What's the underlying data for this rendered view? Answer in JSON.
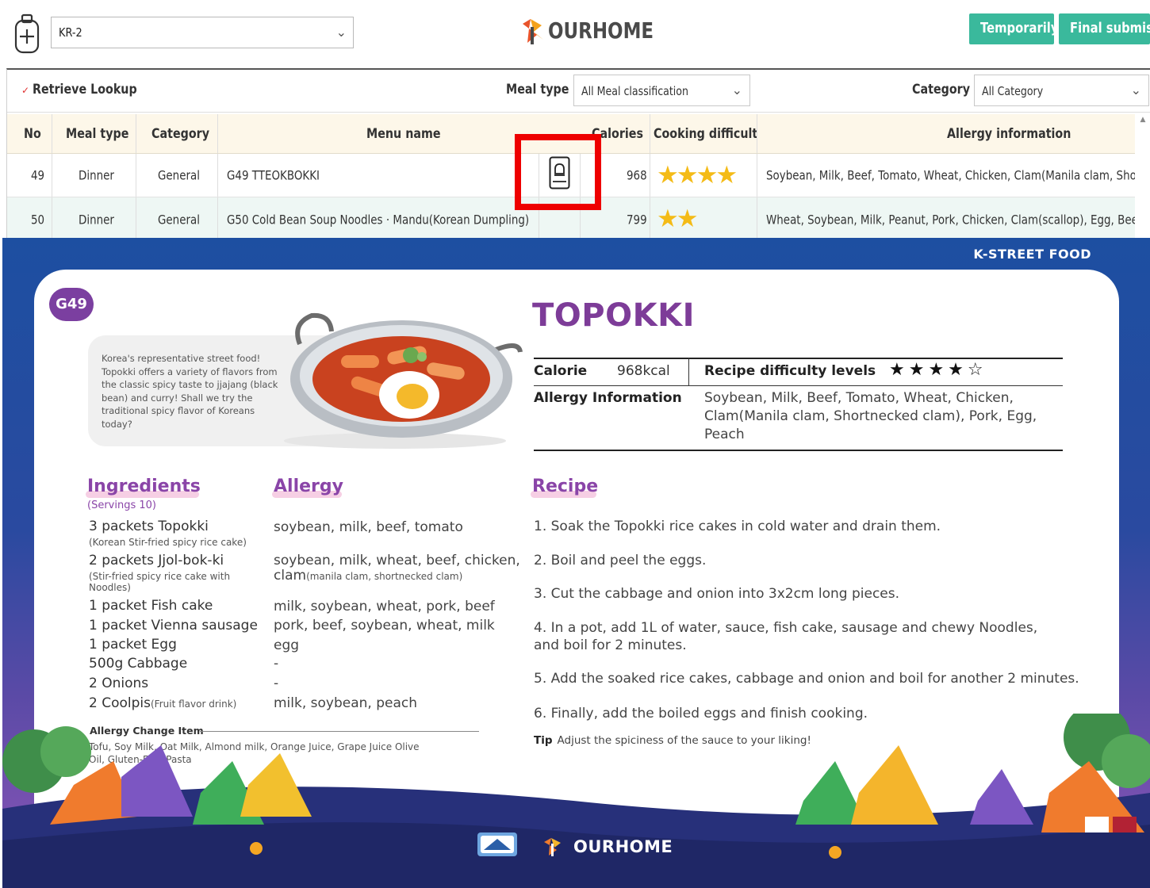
{
  "header": {
    "store_value": "KR-2",
    "brand": "OURHOME",
    "buttons": {
      "temporarily": "Temporarily sa",
      "final": "Final submis"
    }
  },
  "lookup": {
    "title": "Retrieve Lookup",
    "meal_type_label": "Meal type",
    "meal_type_value": "All Meal classification",
    "category_label": "Category",
    "category_value": "All Category",
    "columns": [
      "No",
      "Meal type",
      "Category",
      "Menu name",
      "Calories",
      "Cooking difficulty",
      "Allergy information"
    ],
    "rows": [
      {
        "no": "49",
        "meal_type": "Dinner",
        "category": "General",
        "menu_name": "G49 TTEOKBOKKI",
        "calories": "968",
        "difficulty": 4,
        "allergy": "Soybean, Milk, Beef, Tomato, Wheat, Chicken, Clam(Manila clam, Shortnecked clam)"
      },
      {
        "no": "50",
        "meal_type": "Dinner",
        "category": "General",
        "menu_name": "G50 Cold Bean Soup Noodles · Mandu(Korean Dumpling)",
        "calories": "799",
        "difficulty": 2,
        "allergy": "Wheat, Soybean, Milk, Peanut, Pork, Chicken, Clam(scallop), Egg, Beef"
      }
    ]
  },
  "recipe": {
    "kicker": "K-STREET FOOD",
    "badge": "G49",
    "intro": "Korea's representative street food! Topokki offers a variety of flavors from the classic spicy taste to jjajang (black bean) and curry! Shall we try the traditional spicy flavor of Koreans today?",
    "title": "TOPOKKI",
    "calorie_label": "Calorie",
    "calorie_value": "968kcal",
    "difficulty_label": "Recipe difficulty levels",
    "difficulty_stars": "★★★★☆",
    "difficulty_level": 4,
    "allergy_label": "Allergy Information",
    "allergy_value": "Soybean, Milk, Beef, Tomato, Wheat, Chicken, Clam(Manila clam, Shortnecked clam), Pork, Egg, Peach",
    "ingredients_heading": "Ingredients",
    "servings": "(Servings 10)",
    "allergy_heading": "Allergy",
    "recipe_heading": "Recipe",
    "ingredients": [
      {
        "name": "3 packets Topokki",
        "note": "(Korean Stir-fried spicy rice cake)",
        "allergy": "soybean, milk, beef, tomato",
        "allergy_note": ""
      },
      {
        "name": "2 packets Jjol-bok-ki",
        "note": "(Stir-fried spicy rice cake with Noodles)",
        "allergy": "soybean, milk, wheat, beef, chicken,",
        "allergy2": "clam",
        "allergy_note": "(manila clam, shortnecked clam)"
      },
      {
        "name": "1 packet Fish cake",
        "note": "",
        "allergy": "milk, soybean, wheat, pork, beef"
      },
      {
        "name": "1 packet Vienna sausage",
        "note": "",
        "allergy": "pork, beef, soybean, wheat, milk"
      },
      {
        "name": "1 packet Egg",
        "note": "",
        "allergy": "egg"
      },
      {
        "name": "500g Cabbage",
        "note": "",
        "allergy": "-"
      },
      {
        "name": "2 Onions",
        "note": "",
        "allergy": "-"
      },
      {
        "name": "2 Coolpis",
        "note": "(Fruit flavor drink)",
        "allergy": "milk, soybean, peach"
      }
    ],
    "change_title": "Allergy Change Item",
    "change_items": "Tofu, Soy Milk, Oat Milk, Almond milk, Orange Juice, Grape Juice Olive Oil, Gluten-Free Pasta",
    "steps": [
      "1. Soak the Topokki rice cakes in cold water and drain them.",
      "2. Boil and peel the eggs.",
      "3. Cut the cabbage and onion into 3x2cm long pieces.",
      "4. In a pot, add 1L of water, sauce, fish cake, sausage and chewy Noodles, and boil for 2 minutes.",
      "5. Add the soaked rice cakes, cabbage and onion and boil for another 2 minutes.",
      "6. Finally, add the boiled eggs and finish cooking."
    ],
    "tip_label": "Tip",
    "tip_text": "Adjust the spiciness of the sauce to your liking!",
    "footer_brand": "OURHOME"
  },
  "colors": {
    "accent_green": "#3ab99c",
    "star": "#f4bb17",
    "title_purple": "#7d3c98",
    "highlight": "#ee0000"
  },
  "icons": [
    "tablet-plus-icon",
    "chevron-down-icon",
    "recipe-card-icon",
    "star-icon"
  ]
}
